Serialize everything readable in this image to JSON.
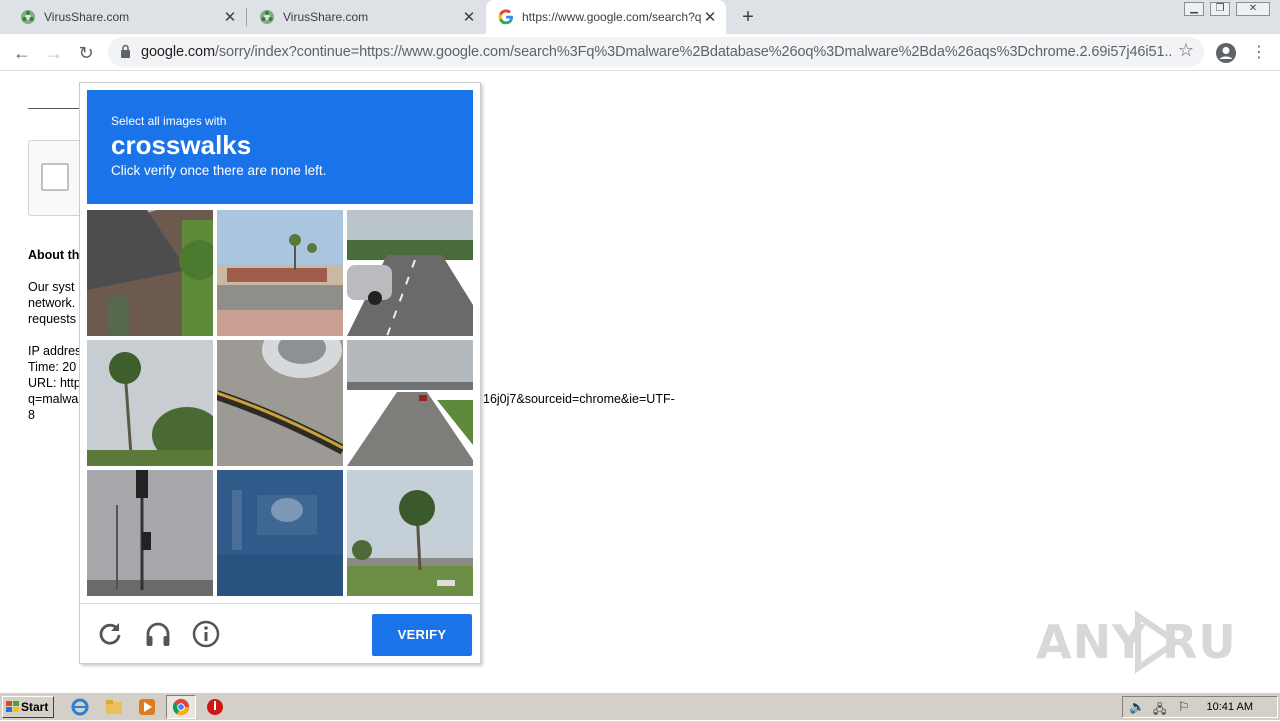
{
  "browser": {
    "tabs": [
      {
        "title": "VirusShare.com",
        "active": false
      },
      {
        "title": "VirusShare.com",
        "active": false
      },
      {
        "title": "https://www.google.com/search?q=",
        "active": true
      }
    ],
    "url_host": "google.com",
    "url_rest": "/sorry/index?continue=https://www.google.com/search%3Fq%3Dmalware%2Bdatabase%26oq%3Dmalware%2Bda%26aqs%3Dchrome.2.69i57j46i51..."
  },
  "page": {
    "about_heading": "About th",
    "line1": "Our syst",
    "line2": "network.",
    "line3": "requests",
    "ip": "IP addres",
    "time": "Time: 20",
    "url": "URL: http",
    "url_q": "q=malwa",
    "url_tail": "16j0j7&sourceid=chrome&ie=UTF-",
    "url_end": "8"
  },
  "challenge": {
    "intro": "Select all images with",
    "target": "crosswalks",
    "hint": "Click verify once there are none left.",
    "verify_label": "VERIFY",
    "tiles": [
      "house-roof",
      "storefront-street",
      "highway-car",
      "palm-tree",
      "tire-curb",
      "highway-overpass",
      "traffic-light",
      "water-blur",
      "palm-park"
    ]
  },
  "watermark": "ANY RUN",
  "taskbar": {
    "start_label": "Start",
    "clock": "10:41 AM"
  }
}
